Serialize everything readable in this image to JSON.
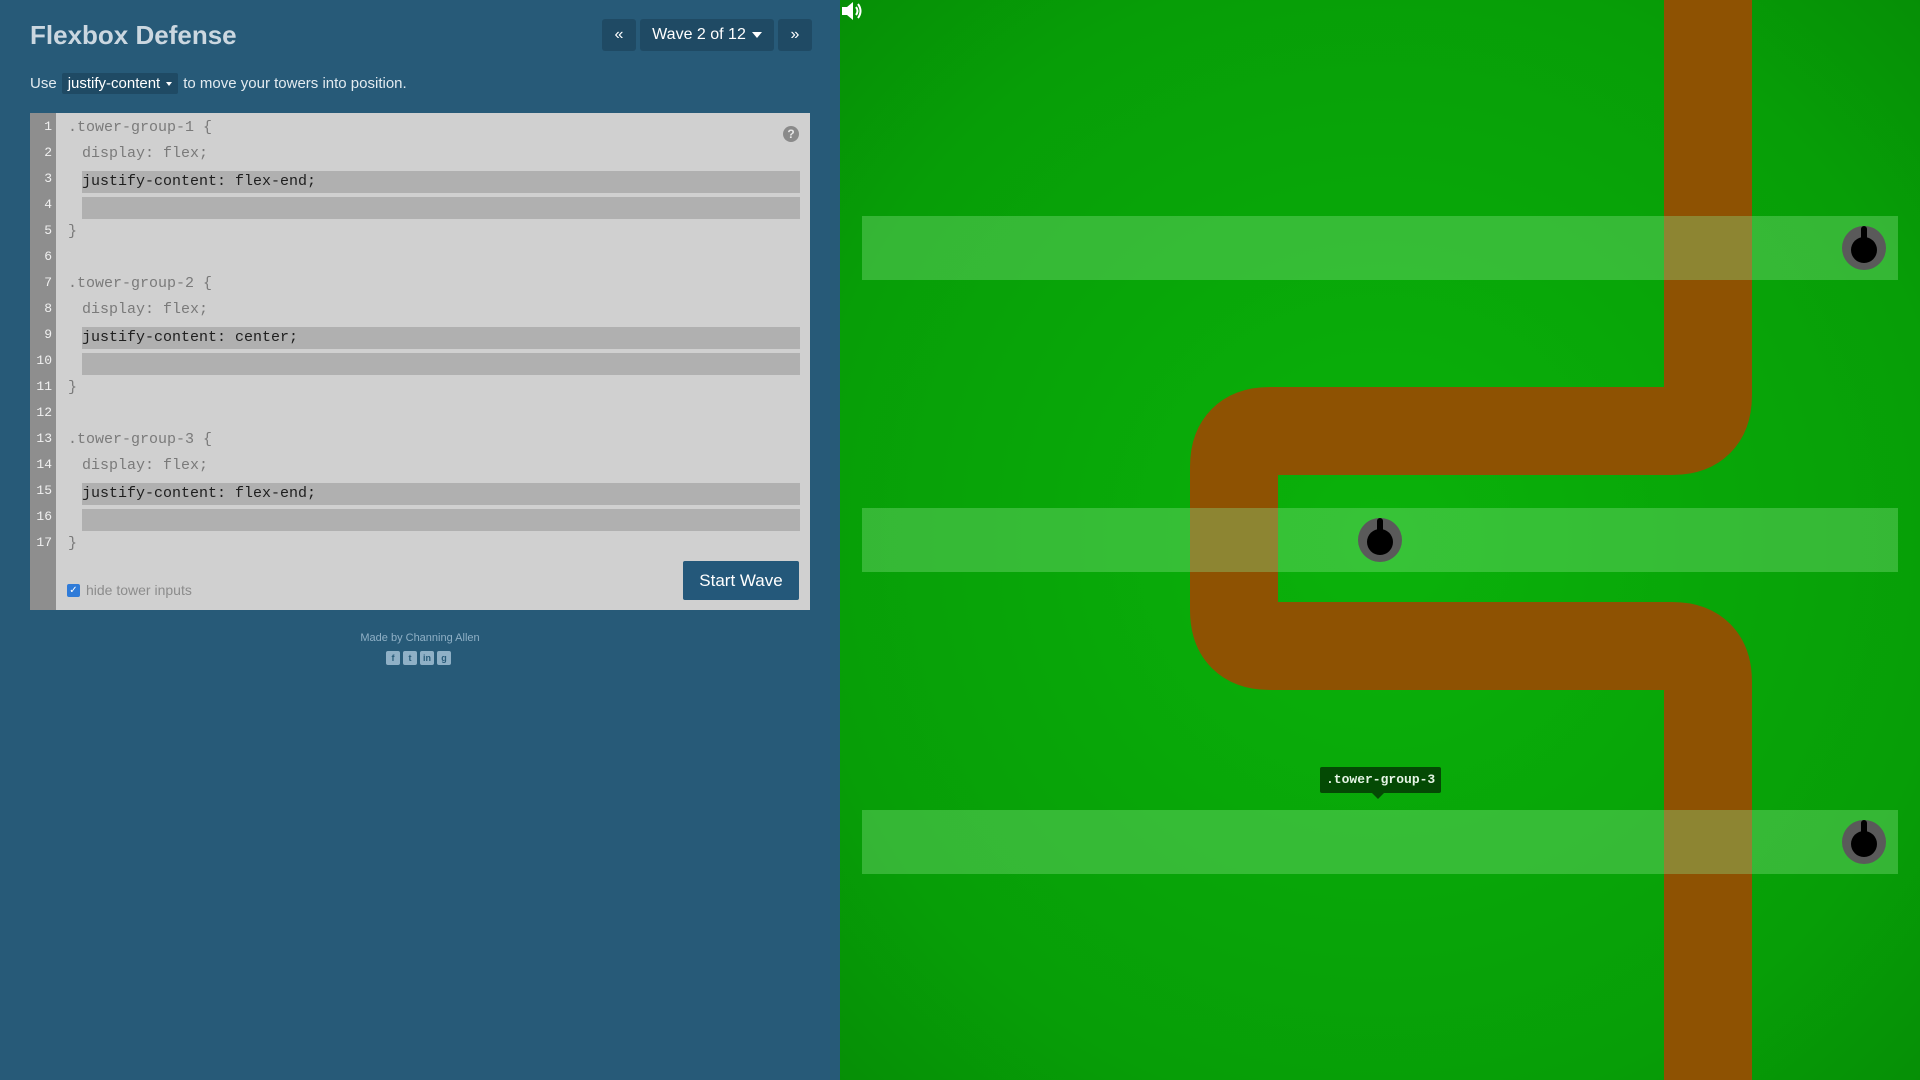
{
  "app": {
    "title": "Flexbox Defense"
  },
  "nav": {
    "prev_label": "«",
    "wave_label": "Wave 2 of 12",
    "next_label": "»"
  },
  "instructions": {
    "prefix": "Use",
    "property": "justify-content",
    "suffix": "to move your towers into position."
  },
  "editor": {
    "line_numbers": [
      "1",
      "2",
      "3",
      "4",
      "5",
      "6",
      "7",
      "8",
      "9",
      "10",
      "11",
      "12",
      "13",
      "14",
      "15",
      "16",
      "17"
    ],
    "lines": [
      ".tower-group-1 {",
      "display: flex;",
      "",
      "",
      "}",
      "",
      ".tower-group-2 {",
      "display: flex;",
      "",
      "",
      "}",
      "",
      ".tower-group-3 {",
      "display: flex;",
      "",
      "",
      "}"
    ],
    "inputs": [
      {
        "line": "3",
        "value": "justify-content: flex-end;"
      },
      {
        "line": "4",
        "value": ""
      },
      {
        "line": "9",
        "value": "justify-content: center;"
      },
      {
        "line": "10",
        "value": ""
      },
      {
        "line": "15",
        "value": "justify-content: flex-end;"
      },
      {
        "line": "16",
        "value": ""
      }
    ],
    "help_icon": "question-icon",
    "hide_inputs_label": "hide tower inputs",
    "hide_inputs_checked": true,
    "start_button": "Start Wave"
  },
  "footer": {
    "credit": "Made by Channing Allen",
    "social": [
      "facebook-icon",
      "twitter-icon",
      "linkedin-icon",
      "github-icon"
    ]
  },
  "game": {
    "sound_icon": "speaker-icon",
    "tooltip": ".tower-group-3",
    "groups": [
      {
        "name": "tower-group-1",
        "justify": "flex-end"
      },
      {
        "name": "tower-group-2",
        "justify": "center"
      },
      {
        "name": "tower-group-3",
        "justify": "flex-end"
      }
    ],
    "colors": {
      "grass": "#0aa50a",
      "path": "#8e5202",
      "row": "#8ce68c",
      "tower_base": "#5a5a5a",
      "tower_top": "#000000"
    }
  }
}
